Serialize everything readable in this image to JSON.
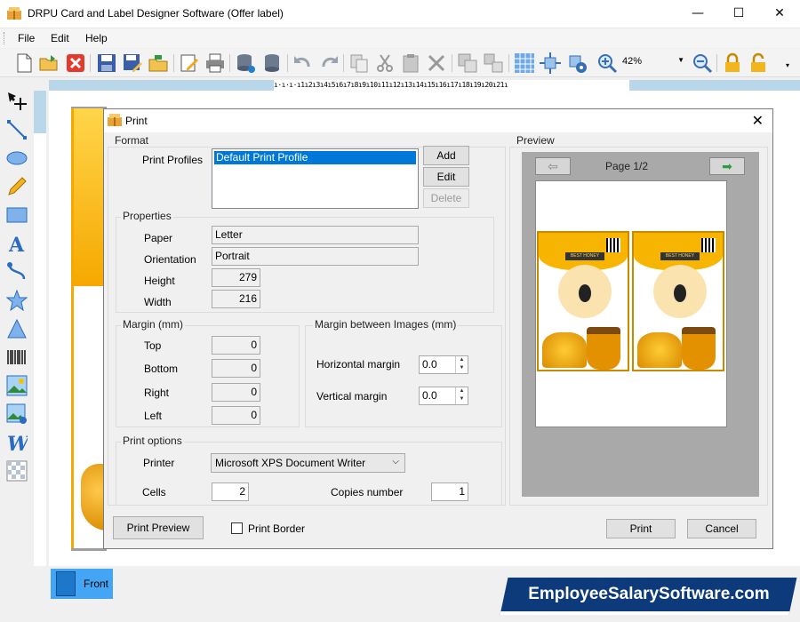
{
  "window": {
    "title": "DRPU Card and Label Designer Software (Offer label)",
    "minimize": "—",
    "maximize": "☐",
    "close": "✕"
  },
  "menu": [
    "File",
    "Edit",
    "Help"
  ],
  "toolbar": {
    "zoom_value": "42%"
  },
  "ruler_text": "ı·ı·ı·ı1ı2ı3ı4ı5ı6ı7ı8ı9ı10ı11ı12ı13ı14ı15ı16ı17ı18ı19ı20ı21ı",
  "bottom": {
    "tab_label": "Front",
    "watermark": "EmployeeSalarySoftware.com"
  },
  "dialog": {
    "title": "Print",
    "format": {
      "group": "Format",
      "print_profiles_label": "Print Profiles",
      "selected_profile": "Default Print Profile",
      "add": "Add",
      "edit": "Edit",
      "delete": "Delete"
    },
    "properties": {
      "group": "Properties",
      "paper_label": "Paper",
      "paper": "Letter",
      "orientation_label": "Orientation",
      "orientation": "Portrait",
      "height_label": "Height",
      "height": "279",
      "width_label": "Width",
      "width": "216"
    },
    "margin": {
      "group": "Margin (mm)",
      "top_label": "Top",
      "top": "0",
      "bottom_label": "Bottom",
      "bottom": "0",
      "right_label": "Right",
      "right": "0",
      "left_label": "Left",
      "left": "0"
    },
    "margin_between": {
      "group": "Margin between Images (mm)",
      "horizontal_label": "Horizontal margin",
      "horizontal": "0.0",
      "vertical_label": "Vertical margin",
      "vertical": "0.0"
    },
    "print_options": {
      "group": "Print options",
      "printer_label": "Printer",
      "printer": "Microsoft XPS Document Writer",
      "cells_label": "Cells",
      "cells": "2",
      "copies_label": "Copies number",
      "copies": "1"
    },
    "preview": {
      "label": "Preview",
      "page": "Page 1/2"
    },
    "buttons": {
      "print_preview": "Print Preview",
      "print_border": "Print Border",
      "print": "Print",
      "cancel": "Cancel"
    }
  },
  "label_text": {
    "badge": "BEST HONEY"
  }
}
